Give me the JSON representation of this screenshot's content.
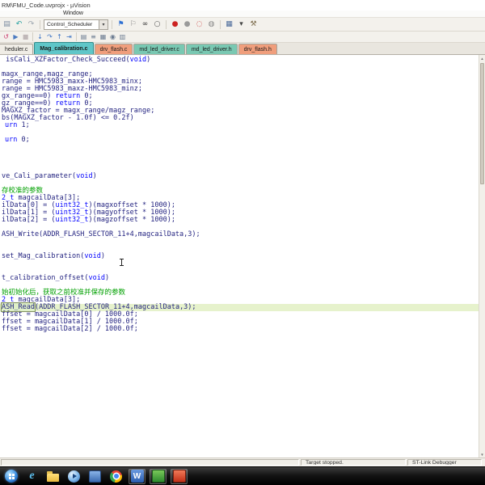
{
  "window": {
    "title": "RM\\FMU_Code.uvprojx - µVision"
  },
  "menu": {
    "items": [
      {
        "label": "Window"
      }
    ]
  },
  "toolbar1": {
    "target_select": "Control_Scheduler",
    "items": [
      {
        "name": "paste-icon",
        "glyph": "▤",
        "color": "#7a8aa0"
      },
      {
        "name": "undo-icon",
        "glyph": "↶",
        "color": "#1f9e9e"
      },
      {
        "name": "redo-icon",
        "glyph": "↷",
        "color": "#9aa4ae"
      },
      {
        "sep": true
      },
      {
        "combo": true
      },
      {
        "sep": true
      },
      {
        "name": "flag-icon",
        "glyph": "⚑",
        "color": "#2d6fd2"
      },
      {
        "name": "flag-clear-icon",
        "glyph": "⚐",
        "color": "#8a8a8a"
      },
      {
        "name": "find-in-files-icon",
        "glyph": "∞",
        "color": "#333333"
      },
      {
        "name": "find-icon",
        "glyph": "○",
        "color": "#555555"
      },
      {
        "sep": true
      },
      {
        "name": "breakpoint-icon",
        "glyph": "●",
        "color": "#cc2222"
      },
      {
        "name": "breakpoint-disable-icon",
        "glyph": "●",
        "color": "#9a9a9a"
      },
      {
        "name": "breakpoint-kill-icon",
        "glyph": "◌",
        "color": "#cc4444"
      },
      {
        "name": "breakpoint-enable-icon",
        "glyph": "◍",
        "color": "#888888"
      },
      {
        "sep": true
      },
      {
        "name": "windows-layout-icon",
        "glyph": "▦",
        "color": "#4a6a9a"
      },
      {
        "name": "layout-dropdown-icon",
        "glyph": "▾",
        "color": "#444444"
      },
      {
        "name": "configure-icon",
        "glyph": "⚒",
        "color": "#7a6a4a"
      }
    ]
  },
  "toolbar2": {
    "items": [
      {
        "name": "reset-icon",
        "glyph": "↺",
        "color": "#cc3a6e"
      },
      {
        "name": "run-icon",
        "glyph": "▶",
        "color": "#4a7ac0"
      },
      {
        "name": "stop-icon",
        "glyph": "■",
        "color": "#c0b8b8"
      },
      {
        "sep": true
      },
      {
        "name": "step-into-icon",
        "glyph": "↓",
        "color": "#3a72c4"
      },
      {
        "name": "step-over-icon",
        "glyph": "↷",
        "color": "#3a72c4"
      },
      {
        "name": "step-out-icon",
        "glyph": "↑",
        "color": "#3a72c4"
      },
      {
        "name": "run-to-cursor-icon",
        "glyph": "⇥",
        "color": "#3a72c4"
      },
      {
        "sep": true
      },
      {
        "name": "command-window-icon",
        "glyph": "▤",
        "color": "#6a7a90"
      },
      {
        "name": "disassembly-window-icon",
        "glyph": "≡",
        "color": "#6a7a90"
      },
      {
        "name": "registers-window-icon",
        "glyph": "▦",
        "color": "#6a7a90"
      },
      {
        "name": "watch-window-icon",
        "glyph": "◉",
        "color": "#6a7a90"
      },
      {
        "name": "memory-window-icon",
        "glyph": "▥",
        "color": "#6a7a90"
      }
    ]
  },
  "tabs": [
    {
      "label": "heduler.c",
      "bg": "#f0ede6",
      "cut": true
    },
    {
      "label": "Mag_calibration.c",
      "bg": "#5fc6c8",
      "active": true
    },
    {
      "label": "drv_flash.c",
      "bg": "#f09e7c"
    },
    {
      "label": "md_led_driver.c",
      "bg": "#79c8b2"
    },
    {
      "label": "md_led_driver.h",
      "bg": "#79c8b2"
    },
    {
      "label": "drv_flash.h",
      "bg": "#f09e7c"
    }
  ],
  "editor": {
    "lines": [
      {
        "s": [
          {
            "t": " isCali_XZFactor_Check_Succeed(",
            "c": "p"
          },
          {
            "t": "void",
            "c": "k"
          },
          {
            "t": ")",
            "c": "p"
          }
        ]
      },
      {
        "s": []
      },
      {
        "s": [
          {
            "t": "magx_range,magz_range;",
            "c": "p"
          }
        ]
      },
      {
        "s": [
          {
            "t": "range = HMC5983_maxx-HMC5983_minx;",
            "c": "p"
          }
        ]
      },
      {
        "s": [
          {
            "t": "range = HMC5983_maxz-HMC5983_minz;",
            "c": "p"
          }
        ]
      },
      {
        "s": [
          {
            "t": "gx_range==0) ",
            "c": "p"
          },
          {
            "t": "return",
            "c": "k"
          },
          {
            "t": " 0;",
            "c": "p"
          }
        ]
      },
      {
        "s": [
          {
            "t": "gz_range==0) ",
            "c": "p"
          },
          {
            "t": "return",
            "c": "k"
          },
          {
            "t": " 0;",
            "c": "p"
          }
        ]
      },
      {
        "s": [
          {
            "t": "MAGXZ_factor = magx_range/magz_range;",
            "c": "p"
          }
        ]
      },
      {
        "s": [
          {
            "t": "bs(MAGXZ_factor - 1.0f) <= 0.2f)",
            "c": "p"
          }
        ]
      },
      {
        "s": [
          {
            "t": "urn",
            "c": "k"
          },
          {
            "t": " 1;",
            "c": "p"
          }
        ],
        "indent": 6
      },
      {
        "s": []
      },
      {
        "s": [
          {
            "t": "urn",
            "c": "k"
          },
          {
            "t": " 0;",
            "c": "p"
          }
        ],
        "indent": 6
      },
      {
        "s": []
      },
      {
        "s": []
      },
      {
        "s": []
      },
      {
        "s": []
      },
      {
        "s": [
          {
            "t": "ve_Cali_parameter(",
            "c": "p"
          },
          {
            "t": "void",
            "c": "k"
          },
          {
            "t": ")",
            "c": "p"
          }
        ]
      },
      {
        "s": []
      },
      {
        "s": [
          {
            "t": "存校准的参数",
            "c": "c"
          }
        ]
      },
      {
        "s": [
          {
            "t": "2_t",
            "c": "k"
          },
          {
            "t": " magcailData[3];",
            "c": "p"
          }
        ]
      },
      {
        "s": [
          {
            "t": "ilData[0] = (",
            "c": "p"
          },
          {
            "t": "uint32_t",
            "c": "k"
          },
          {
            "t": ")(magxoffset * 1000);",
            "c": "p"
          }
        ]
      },
      {
        "s": [
          {
            "t": "ilData[1] = (",
            "c": "p"
          },
          {
            "t": "uint32_t",
            "c": "k"
          },
          {
            "t": ")(magyoffset * 1000);",
            "c": "p"
          }
        ]
      },
      {
        "s": [
          {
            "t": "ilData[2] = (",
            "c": "p"
          },
          {
            "t": "uint32_t",
            "c": "k"
          },
          {
            "t": ")(magzoffset * 1000);",
            "c": "p"
          }
        ]
      },
      {
        "s": []
      },
      {
        "s": [
          {
            "t": "ASH_Write(ADDR_FLASH_SECTOR_11+4,magcailData,3);",
            "c": "p"
          }
        ]
      },
      {
        "s": []
      },
      {
        "s": []
      },
      {
        "s": [
          {
            "t": "set_Mag_calibration(",
            "c": "p"
          },
          {
            "t": "void",
            "c": "k"
          },
          {
            "t": ")",
            "c": "p"
          }
        ]
      },
      {
        "s": []
      },
      {
        "s": []
      },
      {
        "s": [
          {
            "t": "t_calibration_offset(",
            "c": "p"
          },
          {
            "t": "void",
            "c": "k"
          },
          {
            "t": ")",
            "c": "p"
          }
        ]
      },
      {
        "s": []
      },
      {
        "s": [
          {
            "t": "始初始化后，获取之前校准并保存的参数",
            "c": "c"
          }
        ]
      },
      {
        "s": [
          {
            "t": "2_t",
            "c": "k"
          },
          {
            "t": " magcailData[3];",
            "c": "p"
          }
        ]
      },
      {
        "s": [
          {
            "t": "ASH_Read",
            "c": "p",
            "box": true
          },
          {
            "t": "(ADDR_FLASH_SECTOR_11+4,magcailData,3);",
            "c": "p"
          }
        ],
        "hl": true
      },
      {
        "s": [
          {
            "t": "ffset = magcailData[0] / 1000.0f;",
            "c": "p"
          }
        ]
      },
      {
        "s": [
          {
            "t": "ffset = magcailData[1] / 1000.0f;",
            "c": "p"
          }
        ]
      },
      {
        "s": [
          {
            "t": "ffset = magcailData[2] / 1000.0f;",
            "c": "p"
          }
        ]
      }
    ]
  },
  "statusbar": {
    "target": "Target stopped.",
    "debugger": "ST-Link Debugger"
  },
  "taskbar": {
    "icons": [
      {
        "name": "start-button",
        "type": "orb"
      },
      {
        "name": "ie-icon",
        "type": "ie",
        "label": "e"
      },
      {
        "name": "explorer-folder-icon",
        "type": "folder"
      },
      {
        "name": "media-player-icon",
        "type": "media"
      },
      {
        "name": "blue-app-icon",
        "type": "blueapp"
      },
      {
        "name": "chrome-icon",
        "type": "chrome"
      },
      {
        "name": "word-icon",
        "type": "word",
        "label": "W",
        "running": true
      },
      {
        "name": "green-app-icon",
        "type": "green",
        "running": true
      },
      {
        "name": "red-app-icon",
        "type": "red",
        "running": true
      }
    ]
  }
}
